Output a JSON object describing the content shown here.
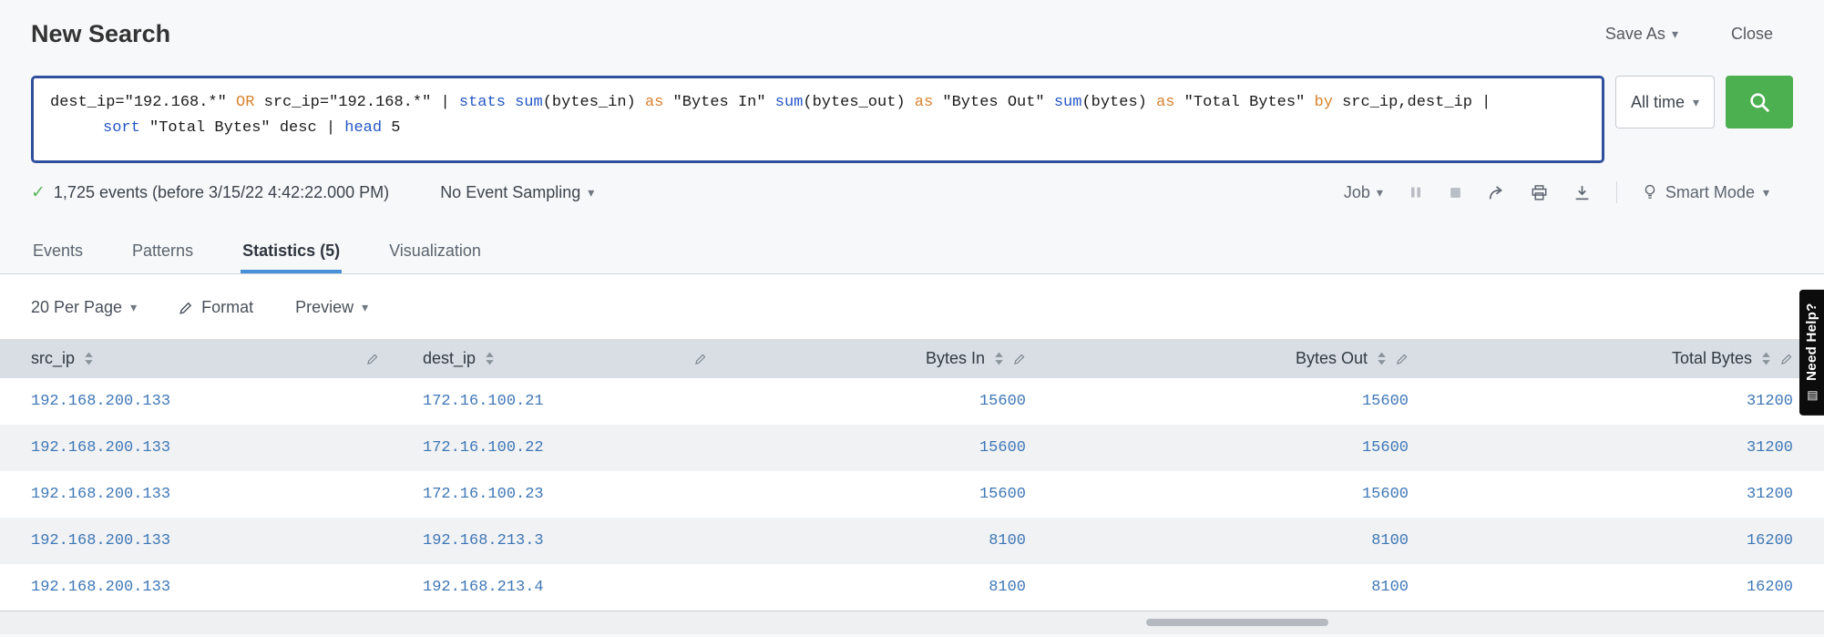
{
  "colors": {
    "accent_green": "#4caf50",
    "focus_border_blue": "#30509d",
    "active_tab_blue": "#4a90d9",
    "value_link_blue": "#3f77b6",
    "command_blue": "#2457c6",
    "keyword_orange": "#d9822f",
    "table_header_bg": "#d8dee3"
  },
  "icons": {
    "caret_down": "▾",
    "check": "✓",
    "help_book": "▤",
    "sort": "sort-arrows-icon",
    "pencil": "pencil-icon",
    "search": "magnifier-icon",
    "pause": "pause-icon",
    "stop": "stop-icon",
    "share": "share-arrow-icon",
    "print": "printer-icon",
    "export": "download-icon",
    "smart_mode": "lightbulb-icon"
  },
  "header": {
    "title": "New Search",
    "save_as_label": "Save As",
    "close_label": "Close"
  },
  "search_bar": {
    "time_range_label": "All time",
    "query_lines": [
      [
        {
          "text": "dest_ip=\"192.168.*\" ",
          "type": "plain"
        },
        {
          "text": "OR",
          "type": "keyword"
        },
        {
          "text": " src_ip=\"192.168.*\" | ",
          "type": "plain"
        },
        {
          "text": "stats",
          "type": "command"
        },
        {
          "text": " ",
          "type": "plain"
        },
        {
          "text": "sum",
          "type": "function"
        },
        {
          "text": "(bytes_in) ",
          "type": "plain"
        },
        {
          "text": "as",
          "type": "keyword"
        },
        {
          "text": " \"Bytes In\" ",
          "type": "plain"
        },
        {
          "text": "sum",
          "type": "function"
        },
        {
          "text": "(bytes_out) ",
          "type": "plain"
        },
        {
          "text": "as",
          "type": "keyword"
        },
        {
          "text": " \"Bytes Out\" ",
          "type": "plain"
        },
        {
          "text": "sum",
          "type": "function"
        },
        {
          "text": "(bytes) ",
          "type": "plain"
        },
        {
          "text": "as",
          "type": "keyword"
        },
        {
          "text": " \"Total Bytes\" ",
          "type": "plain"
        },
        {
          "text": "by",
          "type": "keyword"
        },
        {
          "text": " src_ip,dest_ip |",
          "type": "plain"
        }
      ],
      [
        {
          "text": "sort",
          "type": "command"
        },
        {
          "text": " \"Total Bytes\" desc | ",
          "type": "plain"
        },
        {
          "text": "head",
          "type": "command"
        },
        {
          "text": " 5",
          "type": "plain"
        }
      ]
    ]
  },
  "status_bar": {
    "events_summary": "1,725 events (before 3/15/22 4:42:22.000 PM)",
    "sampling_label": "No Event Sampling",
    "job_label": "Job",
    "smart_mode_label": "Smart Mode"
  },
  "tabs": [
    {
      "label": "Events",
      "active": false
    },
    {
      "label": "Patterns",
      "active": false
    },
    {
      "label": "Statistics (5)",
      "active": true
    },
    {
      "label": "Visualization",
      "active": false
    }
  ],
  "results_toolbar": {
    "per_page_label": "20 Per Page",
    "format_label": "Format",
    "preview_label": "Preview"
  },
  "table": {
    "columns": [
      {
        "label": "src_ip",
        "align": "left"
      },
      {
        "label": "dest_ip",
        "align": "left"
      },
      {
        "label": "Bytes In",
        "align": "right"
      },
      {
        "label": "Bytes Out",
        "align": "right"
      },
      {
        "label": "Total Bytes",
        "align": "right"
      }
    ],
    "rows": [
      [
        "192.168.200.133",
        "172.16.100.21",
        "15600",
        "15600",
        "31200"
      ],
      [
        "192.168.200.133",
        "172.16.100.22",
        "15600",
        "15600",
        "31200"
      ],
      [
        "192.168.200.133",
        "172.16.100.23",
        "15600",
        "15600",
        "31200"
      ],
      [
        "192.168.200.133",
        "192.168.213.3",
        "8100",
        "8100",
        "16200"
      ],
      [
        "192.168.200.133",
        "192.168.213.4",
        "8100",
        "8100",
        "16200"
      ]
    ]
  },
  "help_tab": {
    "label": "Need Help?"
  }
}
